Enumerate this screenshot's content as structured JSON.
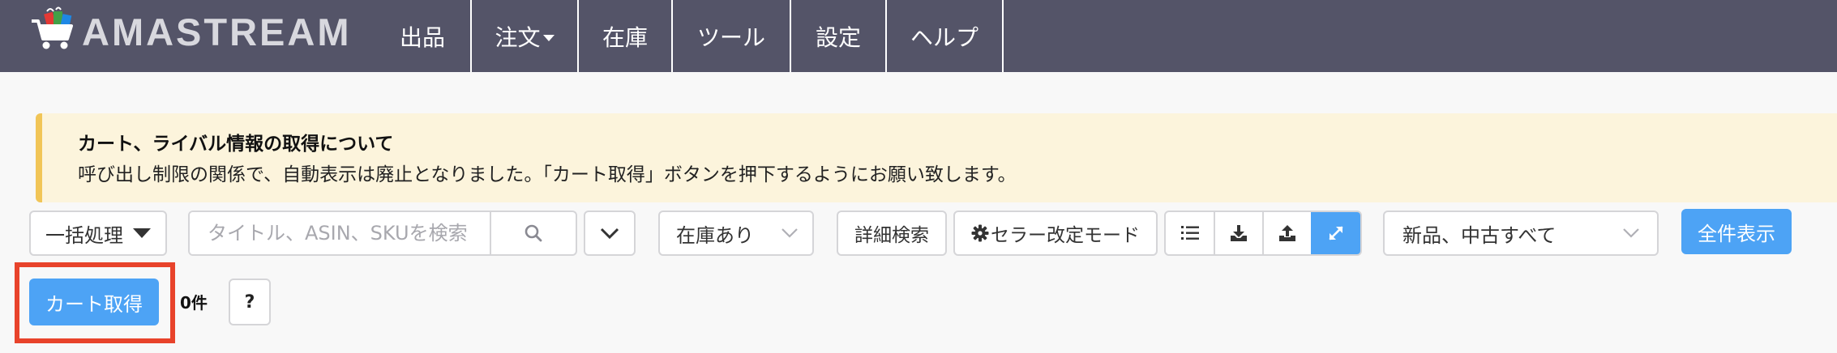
{
  "app": {
    "brand": "AMASTREAM"
  },
  "nav": {
    "items": [
      {
        "label": "出品",
        "width": 118,
        "dropdown": false
      },
      {
        "label": "注文",
        "width": 132,
        "dropdown": true
      },
      {
        "label": "在庫",
        "width": 116,
        "dropdown": false
      },
      {
        "label": "ツール",
        "width": 146,
        "dropdown": false
      },
      {
        "label": "設定",
        "width": 118,
        "dropdown": false
      },
      {
        "label": "ヘルプ",
        "width": 144,
        "dropdown": false
      }
    ]
  },
  "notice": {
    "title": "カート、ライバル情報の取得について",
    "body": "呼び出し制限の関係で、自動表示は廃止となりました。「カート取得」ボタンを押下するようにお願い致します。"
  },
  "toolbar": {
    "bulk_label": "一括処理",
    "search_placeholder": "タイトル、ASIN、SKUを検索",
    "stock_filter": "在庫あり",
    "detail_search_label": "詳細検索",
    "seller_mode_label": "セラー改定モード",
    "condition_filter": "新品、中古すべて",
    "show_all_label": "全件表示",
    "icons": [
      "list-icon",
      "download-icon",
      "upload-icon",
      "expand-icon"
    ]
  },
  "actions": {
    "cart_get_label": "カート取得",
    "count_label": "0件",
    "help_label": "?"
  },
  "colors": {
    "navbar": "#545468",
    "primary": "#4da3f5",
    "notice_bg": "#fcf4dc",
    "notice_border": "#f1c557",
    "highlight": "#e8432b"
  }
}
